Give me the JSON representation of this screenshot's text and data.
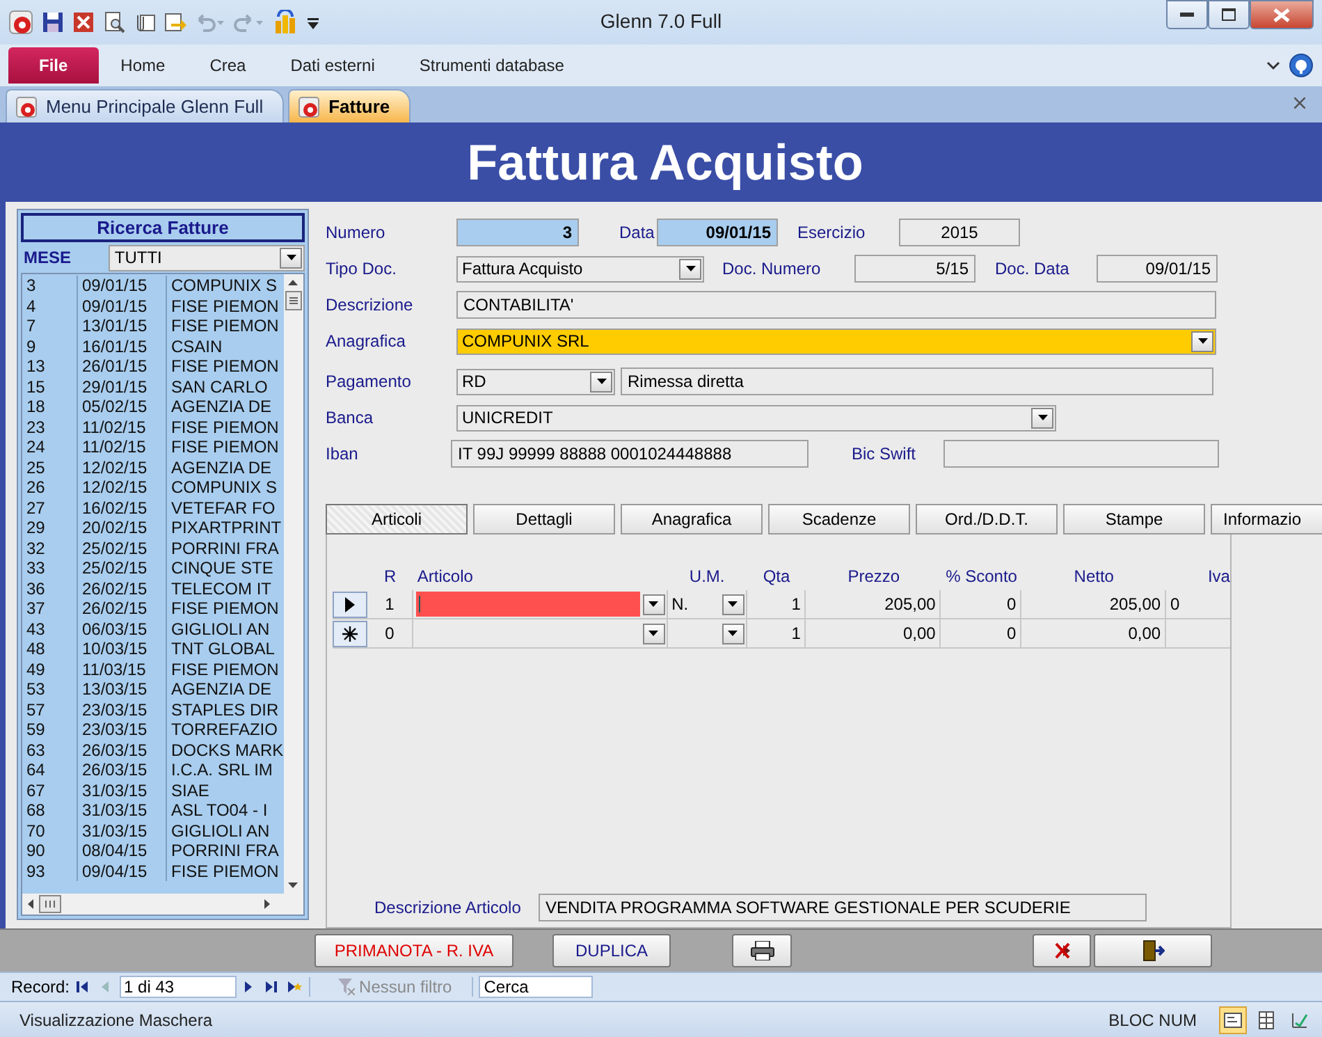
{
  "window": {
    "title": "Glenn 7.0 Full"
  },
  "ribbon_tabs": [
    {
      "label": "File",
      "kind": "file"
    },
    {
      "label": "Home",
      "kind": "tab"
    },
    {
      "label": "Crea",
      "kind": "tab"
    },
    {
      "label": "Dati esterni",
      "kind": "tab"
    },
    {
      "label": "Strumenti database",
      "kind": "tab"
    }
  ],
  "document_tabs": [
    {
      "label": "Menu Principale Glenn Full",
      "selected": false
    },
    {
      "label": "Fatture",
      "selected": true
    }
  ],
  "form": {
    "title": "Fattura Acquisto"
  },
  "search_panel": {
    "title": "Ricerca Fatture",
    "filter_label": "MESE",
    "filter_value": "TUTTI",
    "rows": [
      [
        "3",
        "09/01/15",
        "COMPUNIX S"
      ],
      [
        "4",
        "09/01/15",
        "FISE PIEMON"
      ],
      [
        "7",
        "13/01/15",
        "FISE PIEMON"
      ],
      [
        "9",
        "16/01/15",
        "CSAIN"
      ],
      [
        "13",
        "26/01/15",
        "FISE PIEMON"
      ],
      [
        "15",
        "29/01/15",
        "SAN CARLO"
      ],
      [
        "18",
        "05/02/15",
        "AGENZIA DE"
      ],
      [
        "23",
        "11/02/15",
        "FISE PIEMON"
      ],
      [
        "24",
        "11/02/15",
        "FISE PIEMON"
      ],
      [
        "25",
        "12/02/15",
        "AGENZIA DE"
      ],
      [
        "26",
        "12/02/15",
        "COMPUNIX S"
      ],
      [
        "27",
        "16/02/15",
        "VETEFAR FO"
      ],
      [
        "29",
        "20/02/15",
        "PIXARTPRINT"
      ],
      [
        "32",
        "25/02/15",
        "PORRINI FRA"
      ],
      [
        "33",
        "25/02/15",
        "CINQUE STE"
      ],
      [
        "36",
        "26/02/15",
        "TELECOM IT"
      ],
      [
        "37",
        "26/02/15",
        "FISE PIEMON"
      ],
      [
        "43",
        "06/03/15",
        "GIGLIOLI AN"
      ],
      [
        "48",
        "10/03/15",
        "TNT GLOBAL"
      ],
      [
        "49",
        "11/03/15",
        "FISE PIEMON"
      ],
      [
        "53",
        "13/03/15",
        "AGENZIA DE"
      ],
      [
        "57",
        "23/03/15",
        "STAPLES DIR"
      ],
      [
        "59",
        "23/03/15",
        "TORREFAZIO"
      ],
      [
        "63",
        "26/03/15",
        "DOCKS MARK"
      ],
      [
        "64",
        "26/03/15",
        "I.C.A. SRL IM"
      ],
      [
        "67",
        "31/03/15",
        "SIAE"
      ],
      [
        "68",
        "31/03/15",
        "ASL TO04 - I"
      ],
      [
        "70",
        "31/03/15",
        "GIGLIOLI AN"
      ],
      [
        "90",
        "08/04/15",
        "PORRINI FRA"
      ],
      [
        "93",
        "09/04/15",
        "FISE PIEMON"
      ]
    ]
  },
  "fields": {
    "numero": {
      "label": "Numero",
      "value": "3"
    },
    "data": {
      "label": "Data",
      "value": "09/01/15"
    },
    "esercizio": {
      "label": "Esercizio",
      "value": "2015"
    },
    "tipo_doc": {
      "label": "Tipo Doc.",
      "value": "Fattura Acquisto"
    },
    "doc_numero": {
      "label": "Doc. Numero",
      "value": "5/15"
    },
    "doc_data": {
      "label": "Doc. Data",
      "value": "09/01/15"
    },
    "descrizione": {
      "label": "Descrizione",
      "value": "CONTABILITA'"
    },
    "anagrafica": {
      "label": "Anagrafica",
      "value": "COMPUNIX SRL"
    },
    "pagamento": {
      "label": "Pagamento",
      "code": "RD",
      "description": "Rimessa diretta"
    },
    "banca": {
      "label": "Banca",
      "value": "UNICREDIT"
    },
    "iban": {
      "label": "Iban",
      "value": "IT 99J 99999 88888 0001024448888"
    },
    "bic_swift": {
      "label": "Bic Swift"
    }
  },
  "subform_tabs": [
    {
      "label": "Articoli",
      "selected": true
    },
    {
      "label": "Dettagli",
      "selected": false
    },
    {
      "label": "Anagrafica",
      "selected": false
    },
    {
      "label": "Scadenze",
      "selected": false
    },
    {
      "label": "Ord./D.D.T.",
      "selected": false
    },
    {
      "label": "Stampe",
      "selected": false
    },
    {
      "label": "Informazio",
      "selected": false
    }
  ],
  "grid": {
    "columns": [
      "R",
      "Articolo",
      "U.M.",
      "Qta",
      "Prezzo",
      "% Sconto",
      "Netto",
      "Iva"
    ],
    "rows": [
      {
        "kind": "current",
        "highlighted": true,
        "r": "1",
        "um": "N.",
        "qta": "1",
        "prezzo": "205,00",
        "sconto": "0",
        "netto": "205,00",
        "iva": "0"
      },
      {
        "kind": "new",
        "highlighted": false,
        "r": "0",
        "qta": "1",
        "prezzo": "0,00",
        "sconto": "0",
        "netto": "0,00"
      }
    ]
  },
  "article_description": {
    "label": "Descrizione Articolo",
    "value": "VENDITA PROGRAMMA SOFTWARE GESTIONALE PER SCUDERIE"
  },
  "buttons": [
    {
      "kind": "text",
      "label": "PRIMANOTA - R. IVA",
      "color": "#e00000"
    },
    {
      "kind": "text",
      "label": "DUPLICA",
      "color": "#1a1a8c"
    },
    {
      "kind": "print"
    },
    {
      "kind": "delete"
    },
    {
      "kind": "exit"
    }
  ],
  "record_nav": {
    "label": "Record:",
    "position": "1 di 43",
    "filter": "Nessun filtro",
    "search": {
      "placeholder": "Cerca"
    }
  },
  "status_bar": {
    "text": "Visualizzazione Maschera",
    "indicator": "BLOC NUM",
    "views": [
      {
        "kind": "form",
        "selected": true
      },
      {
        "kind": "datasheet",
        "selected": false
      },
      {
        "kind": "layout",
        "selected": false
      }
    ]
  }
}
